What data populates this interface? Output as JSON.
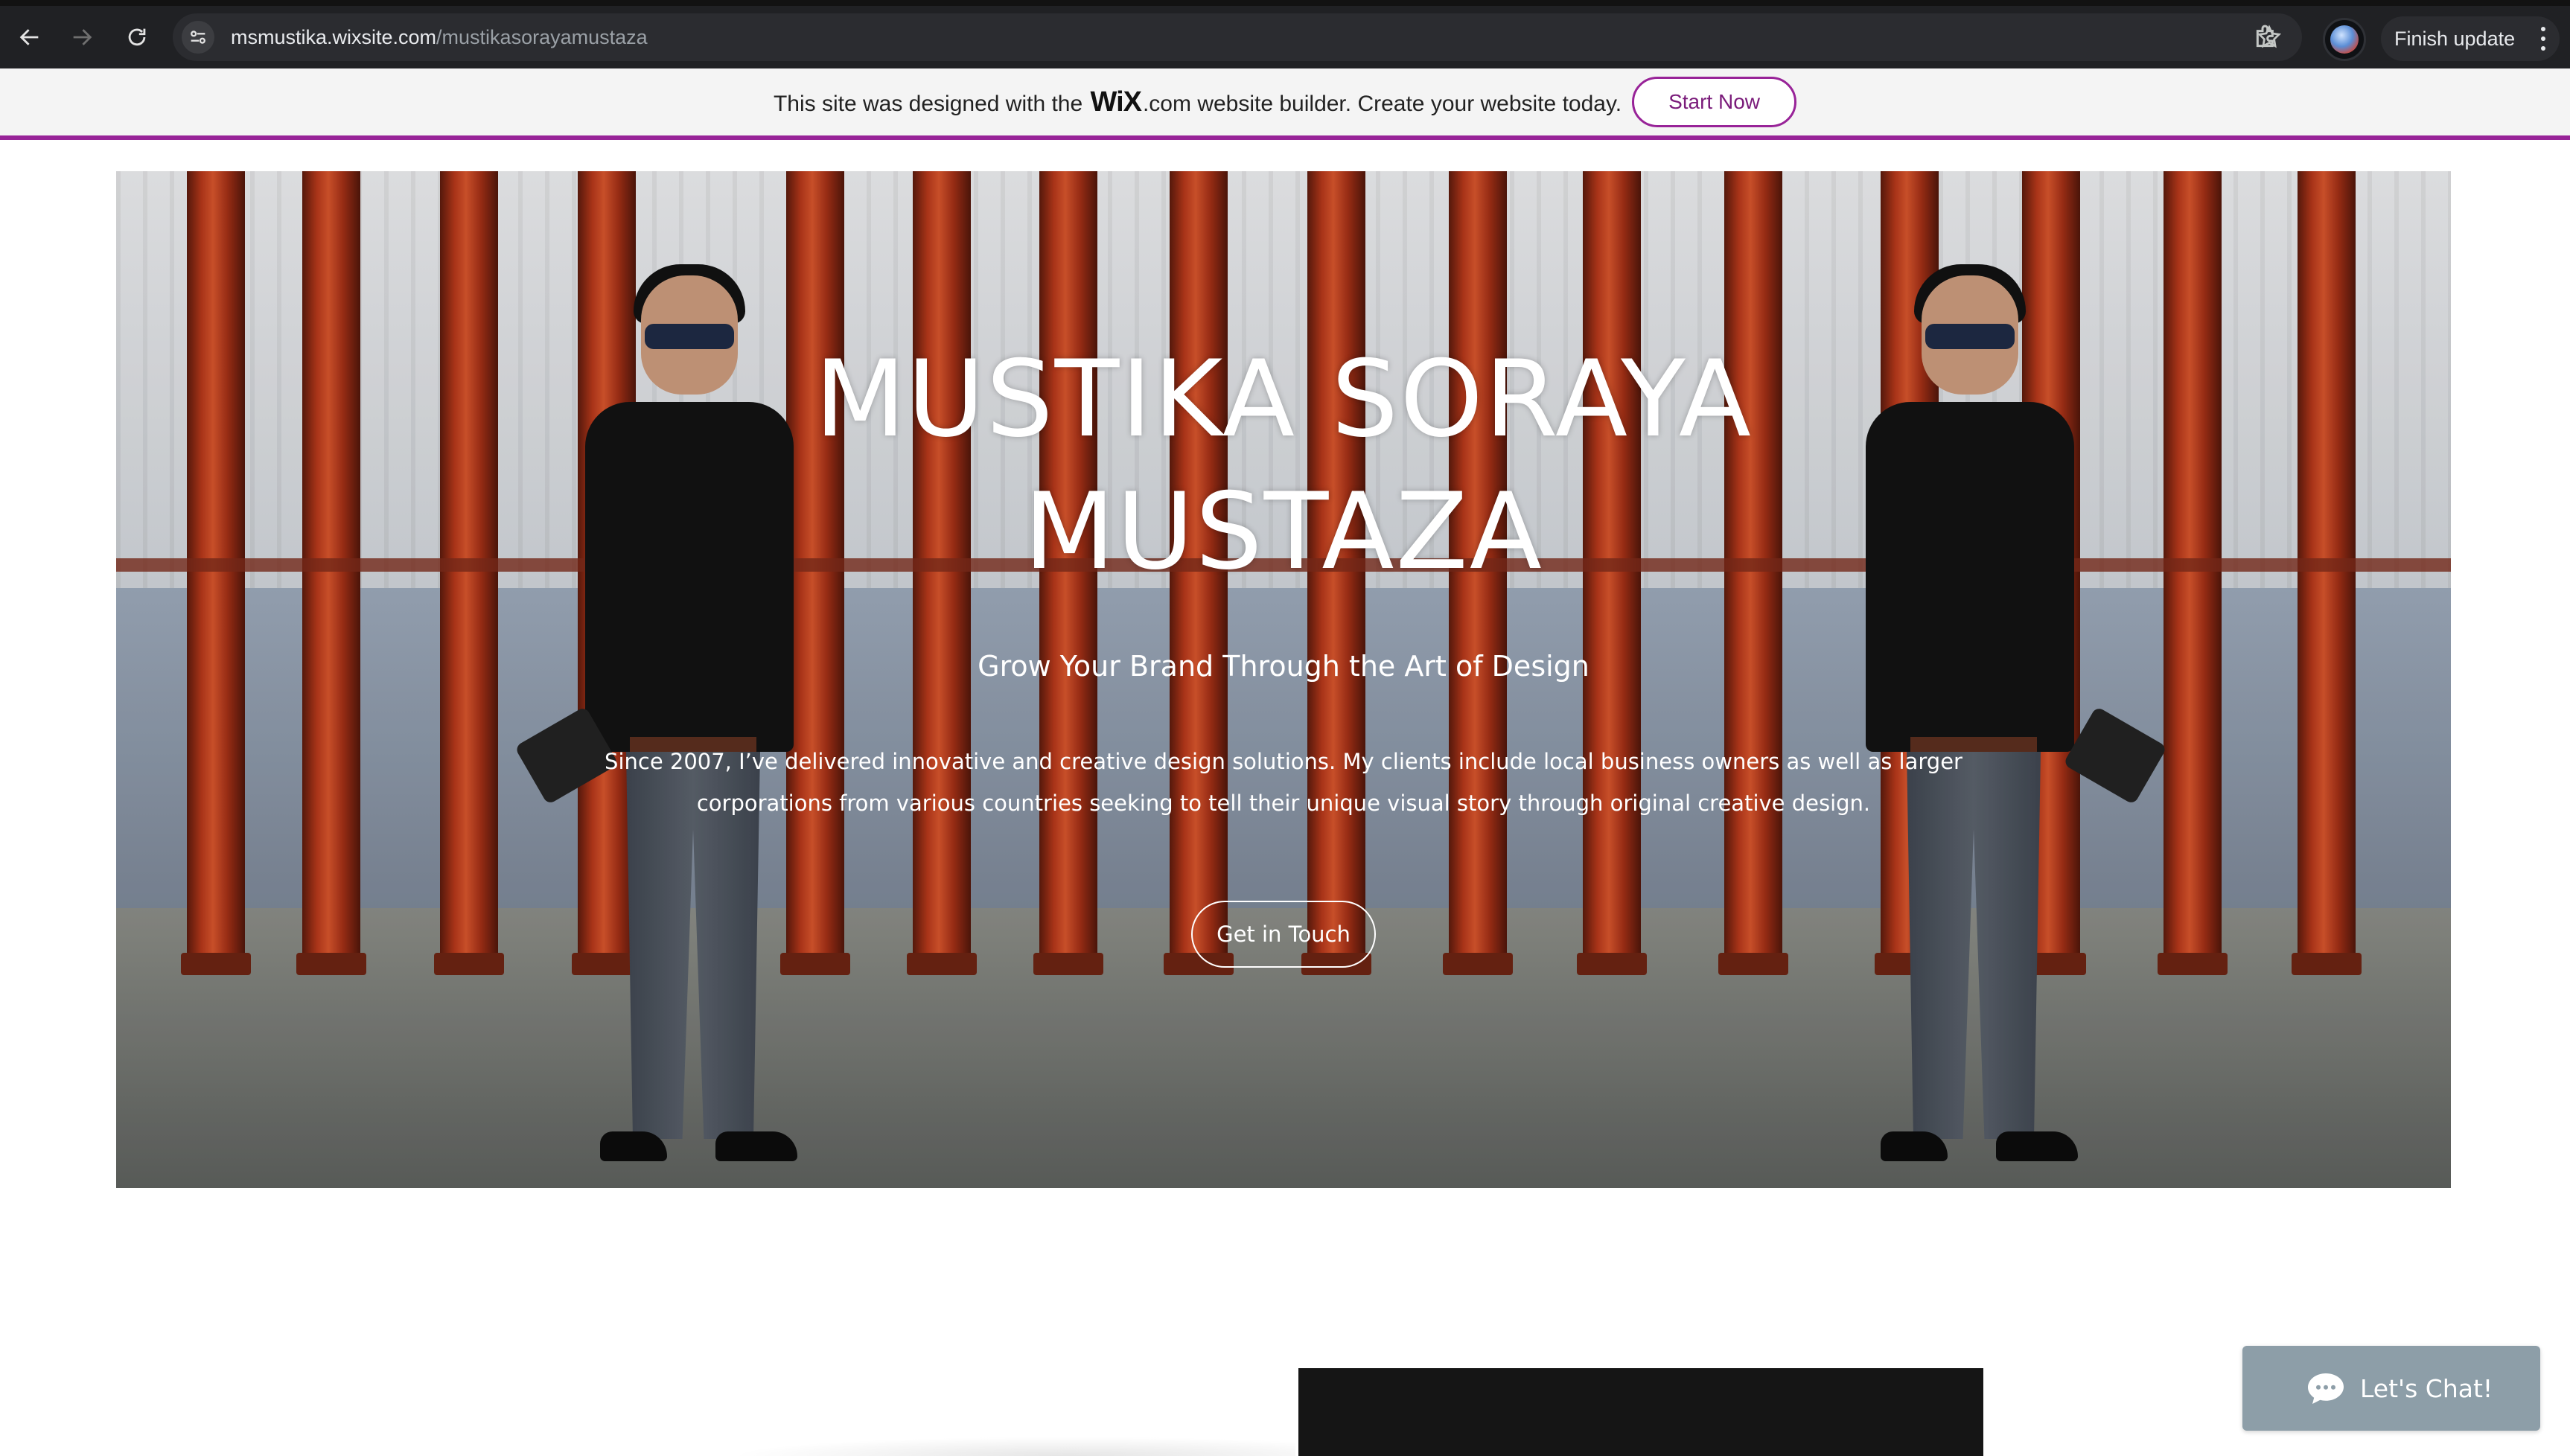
{
  "browser": {
    "url_host": "msmustika.wixsite.com",
    "url_path": "/mustikasorayamustaza",
    "finish_update_label": "Finish update",
    "icons": [
      "back-icon",
      "forward-icon",
      "reload-icon",
      "site-info-icon",
      "star-icon",
      "extensions-icon",
      "profile-avatar",
      "more-icon"
    ]
  },
  "wix_banner": {
    "text_before": "This site was designed with the",
    "logo_text": "WiX",
    "text_after": ".com website builder. Create your website today.",
    "cta_label": "Start Now",
    "accent_color": "#982398"
  },
  "hero": {
    "title_line1": "MUSTIKA SORAYA",
    "title_line2": "MUSTAZA",
    "subtitle": "Grow Your Brand Through the Art of Design",
    "body": "Since 2007, I’ve delivered innovative and creative design solutions. My clients include local business owners as well as larger corporations from various countries seeking to tell their unique visual story through original creative design.",
    "cta_label": "Get in Touch"
  },
  "chat": {
    "label": "Let's Chat!",
    "color": "#8d9ea8"
  }
}
